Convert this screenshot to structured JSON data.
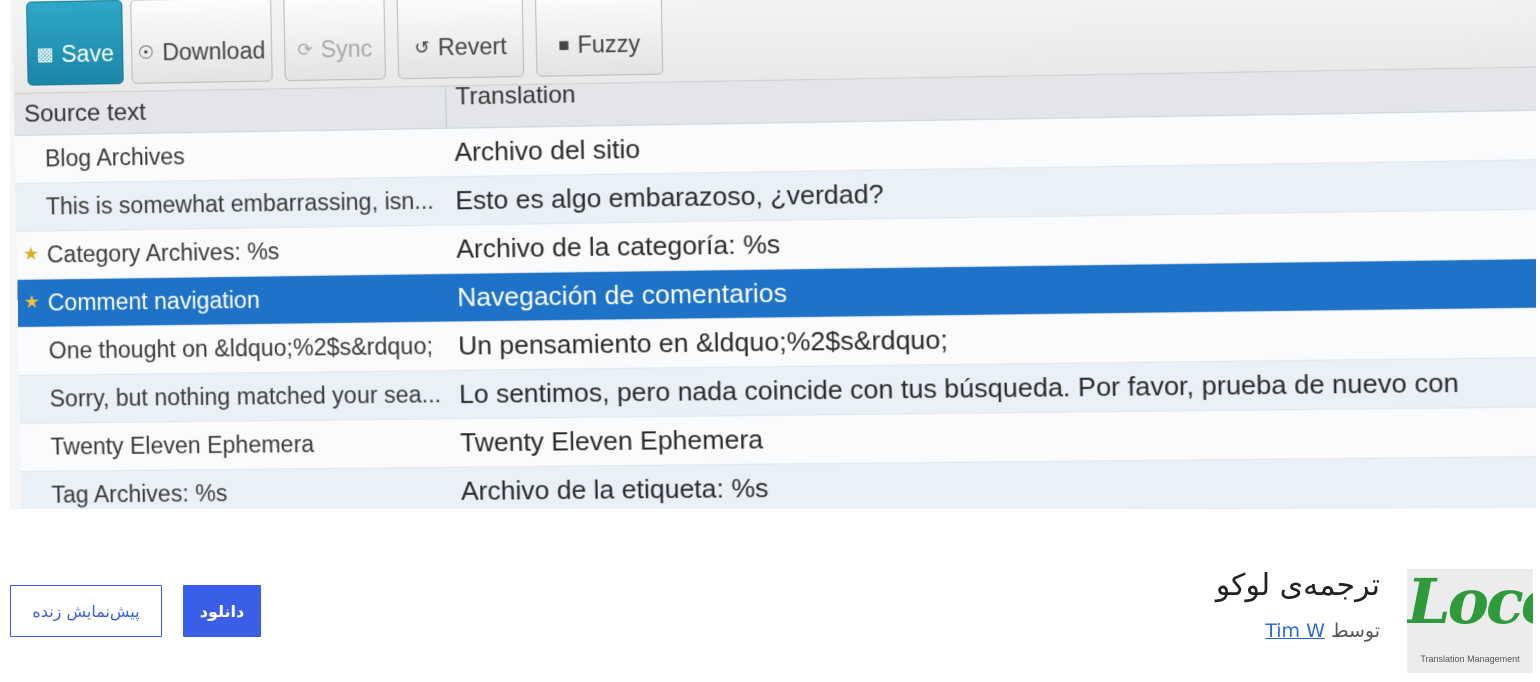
{
  "banner": {
    "toolbar": {
      "save_label": "Save",
      "download_label": "Download",
      "sync_label": "Sync",
      "revert_label": "Revert",
      "fuzzy_label": "Fuzzy"
    },
    "columns": {
      "source": "Source text",
      "translation": "Translation"
    },
    "rows": [
      {
        "source": "Blog Archives",
        "translation": "Archivo del sitio",
        "starred": false,
        "selected": false
      },
      {
        "source": "This is somewhat embarrassing, isn...",
        "translation": "Esto es algo embarazoso, ¿verdad?",
        "starred": false,
        "selected": false
      },
      {
        "source": "Category Archives: %s",
        "translation": "Archivo de la categoría: %s",
        "starred": true,
        "selected": false
      },
      {
        "source": "Comment navigation",
        "translation": "Navegación de comentarios",
        "starred": true,
        "selected": true
      },
      {
        "source": "One thought on &ldquo;%2$s&rdquo;",
        "translation": "Un pensamiento en &ldquo;%2$s&rdquo;",
        "starred": false,
        "selected": false
      },
      {
        "source": "Sorry, but nothing matched your sea...",
        "translation": "Lo sentimos, pero nada coincide con tus búsqueda. Por favor, prueba de nuevo con",
        "starred": false,
        "selected": false
      },
      {
        "source": "Twenty Eleven Ephemera",
        "translation": "Twenty Eleven Ephemera",
        "starred": false,
        "selected": false
      },
      {
        "source": "Tag Archives: %s",
        "translation": "Archivo de la etiqueta: %s",
        "starred": false,
        "selected": false
      }
    ]
  },
  "plugin": {
    "logo_text": "Loco",
    "logo_tagline": "Translation Management",
    "title": "ترجمه‌ی لوکو",
    "author_prefix": "توسط",
    "author_name": "Tim W"
  },
  "actions": {
    "download_label": "دانلود",
    "preview_label": "پیش‌نمایش زنده"
  },
  "colors": {
    "accent": "#3a5ee8",
    "selected_row": "#1e72c8",
    "save_button": "#1f93b8",
    "logo_green": "#2f9a3b",
    "star": "#e0a91c"
  }
}
